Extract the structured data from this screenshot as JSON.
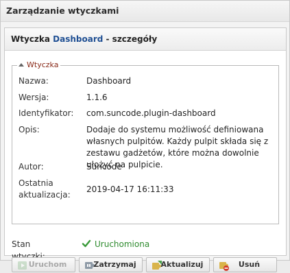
{
  "outer_title": "Zarządzanie wtyczkami",
  "panel": {
    "title_prefix": "Wtyczka ",
    "plugin_name": "Dashboard",
    "title_suffix": " - szczegóły"
  },
  "fieldset": {
    "legend": "Wtyczka",
    "rows": [
      {
        "label": "Nazwa:",
        "value": "Dashboard"
      },
      {
        "label": "Wersja:",
        "value": "1.1.6"
      },
      {
        "label": "Identyfikator:",
        "value": "com.suncode.plugin-dashboard"
      },
      {
        "label": "Opis:",
        "value": "Dodaje do systemu możliwość definiowana własnych pulpitów. Każdy pulpit składa się z zestawu gadżetów, które można dowolnie ułożyć na pulpicie."
      },
      {
        "label": "Autor:",
        "value": "Suncode"
      },
      {
        "label": "Ostatnia aktualizacja:",
        "value": "2019-04-17 16:11:33"
      }
    ]
  },
  "status": {
    "label": "Stan wtyczki:",
    "value": "Uruchomiona",
    "icon": "checkmark-icon",
    "color": "#2e8b2e"
  },
  "buttons": {
    "start": "Uruchom",
    "stop": "Zatrzymaj",
    "update": "Aktualizuj",
    "remove": "Usuń"
  }
}
